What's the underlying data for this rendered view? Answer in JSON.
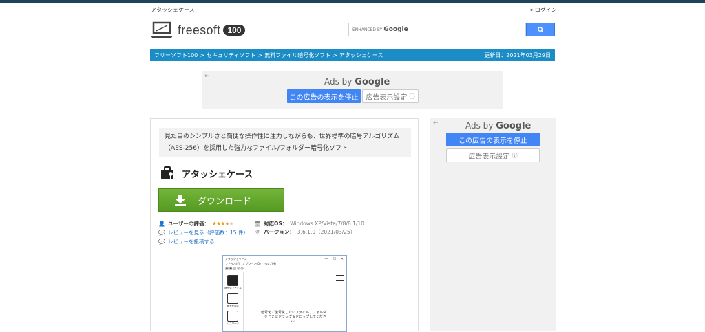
{
  "header": {
    "site_name": "アタッシェケース",
    "login_label": "ログイン",
    "logo_brand": "freesoft",
    "logo_number": "100"
  },
  "search": {
    "enhanced_prefix": "ENHANCED BY",
    "provider": "Google",
    "button_icon": "search-icon"
  },
  "breadcrumb": {
    "items": [
      "フリーソフト100",
      "セキュリティソフト",
      "無料ファイル暗号化ソフト"
    ],
    "separator": ">",
    "current": "アタッシェケース",
    "updated": "更新日：2021年03月29日"
  },
  "ads": {
    "ads_by": "Ads by",
    "google": "Google",
    "stop_label": "この広告の表示を停止",
    "settings_label": "広告表示設定",
    "info_glyph": "ⓘ",
    "back_glyph": "←"
  },
  "app": {
    "description": "見た目のシンプルさと簡便な操作性に注力しながらも、世界標準の暗号アルゴリズム（AES-256）を採用した強力なファイル/フォルダー暗号化ソフト",
    "title": "アタッシェケース",
    "download_label": "ダウンロード",
    "user_rating_label": "ユーザーの評価：",
    "rating_stars": 4,
    "rating_max": 5,
    "review_link": "レビューを見る（評価数：15 件）",
    "post_review_link": "レビューを投稿する",
    "os_label": "対応OS：",
    "os_value": "Windows XP/Vista/7/8/8.1/10",
    "version_label": "バージョン：",
    "version_value": "3.6.1.0（2021/03/25）"
  },
  "screenshot": {
    "window_title": "アタッシェケース",
    "menu": "ファイル(F)　オプション(O)　ヘルプ(H)",
    "side_captions": [
      "暗号化ファイル",
      "暗号化設定",
      "パスワード"
    ],
    "drop_text": "暗号化／復号化したいファイル、フォルダーをここにドラッグ＆ドロップしてください。"
  },
  "colors": {
    "breadcrumb_bg": "#1b8cc6",
    "download_green": "#5fa629",
    "ad_button_blue": "#4285f4",
    "top_bar": "#1d4458"
  }
}
